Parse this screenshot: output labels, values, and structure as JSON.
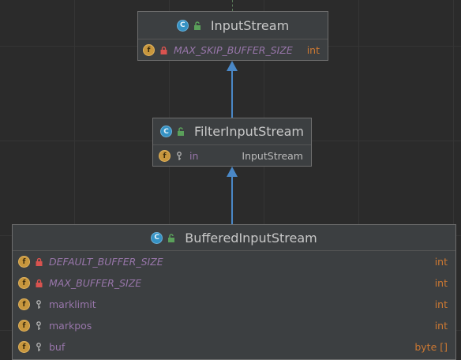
{
  "diagram": {
    "input_stream": {
      "title": "InputStream",
      "fields": [
        {
          "name": "MAX_SKIP_BUFFER_SIZE",
          "type": "int",
          "static": true,
          "visibility": "private",
          "icon": "field-icon"
        }
      ]
    },
    "filter_input_stream": {
      "title": "FilterInputStream",
      "fields": [
        {
          "name": "in",
          "type": "InputStream",
          "static": false,
          "visibility": "protected",
          "icon": "field-icon"
        }
      ]
    },
    "buffered_input_stream": {
      "title": "BufferedInputStream",
      "fields": [
        {
          "name": "DEFAULT_BUFFER_SIZE",
          "type": "int",
          "static": true,
          "visibility": "private",
          "icon": "field-icon"
        },
        {
          "name": "MAX_BUFFER_SIZE",
          "type": "int",
          "static": true,
          "visibility": "private",
          "icon": "field-icon"
        },
        {
          "name": "marklimit",
          "type": "int",
          "static": false,
          "visibility": "protected",
          "icon": "field-icon"
        },
        {
          "name": "markpos",
          "type": "int",
          "static": false,
          "visibility": "protected",
          "icon": "field-icon"
        },
        {
          "name": "buf",
          "type": "byte []",
          "static": false,
          "visibility": "protected",
          "icon": "field-icon"
        }
      ]
    },
    "icon_letters": {
      "class": "C",
      "field": "f"
    },
    "colors": {
      "background": "#2b2b2b",
      "node_fill": "#3c3f41",
      "field_name": "#9876aa",
      "primitive_type": "#cc7832",
      "inheritance_arrow": "#4a88c7",
      "class_icon": "#3592c4",
      "field_icon": "#c7963d"
    }
  }
}
